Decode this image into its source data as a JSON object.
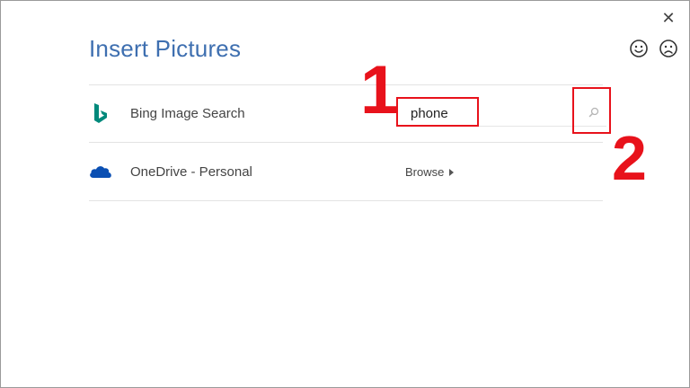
{
  "dialog": {
    "title": "Insert Pictures",
    "close_icon": "close-icon",
    "feedback": {
      "smile_icon": "smiley-face-icon",
      "frown_icon": "frown-face-icon"
    }
  },
  "sources": [
    {
      "icon": "bing-logo-icon",
      "label": "Bing Image Search",
      "color": "#00897b",
      "search": {
        "value": "phone",
        "placeholder": "",
        "button_icon": "search-icon"
      }
    },
    {
      "icon": "onedrive-cloud-icon",
      "label": "OneDrive - Personal",
      "color": "#0a4fb3",
      "browse_label": "Browse"
    }
  ],
  "annotations": [
    {
      "label": "1",
      "color": "#e8121b"
    },
    {
      "label": "2",
      "color": "#e8121b"
    }
  ],
  "colors": {
    "title": "#3e6fb0",
    "accent_red": "#e8121b",
    "divider": "#e3e3e3"
  }
}
